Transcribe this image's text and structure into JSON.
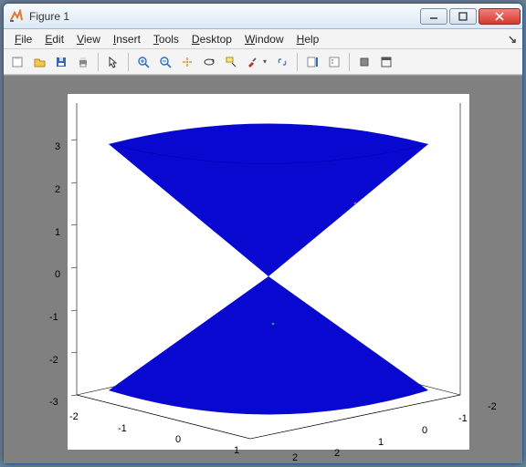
{
  "window": {
    "title": "Figure 1"
  },
  "menu": {
    "file": "File",
    "edit": "Edit",
    "view": "View",
    "insert": "Insert",
    "tools": "Tools",
    "desktop": "Desktop",
    "window": "Window",
    "help": "Help"
  },
  "toolbar_names": [
    "new",
    "open",
    "save",
    "print",
    "select",
    "zoom-in",
    "zoom-out",
    "pan",
    "rotate",
    "data-cursor",
    "brush",
    "link",
    "insert-colorbar",
    "insert-legend",
    "hide-tools",
    "dock"
  ],
  "chart_data": {
    "type": "surface",
    "description": "3D double cone (hourglass) surface centered at origin",
    "surface": {
      "shape": "double-cone",
      "apex": [
        0,
        0,
        0
      ],
      "radius": 2,
      "height": 3,
      "color": "#0808d0"
    },
    "xlim": [
      -2,
      2
    ],
    "ylim": [
      -2,
      2
    ],
    "zlim": [
      -3,
      3
    ],
    "xticks": [
      -2,
      -1,
      0,
      1,
      2
    ],
    "yticks": [
      -2,
      -1,
      0,
      1,
      2
    ],
    "zticks": [
      -3,
      -2,
      -1,
      0,
      1,
      2,
      3
    ],
    "xlabel": "",
    "ylabel": "",
    "zlabel": "",
    "title": "",
    "view": "3d-isometric",
    "background": "#808080",
    "axes_bg": "#ffffff"
  }
}
